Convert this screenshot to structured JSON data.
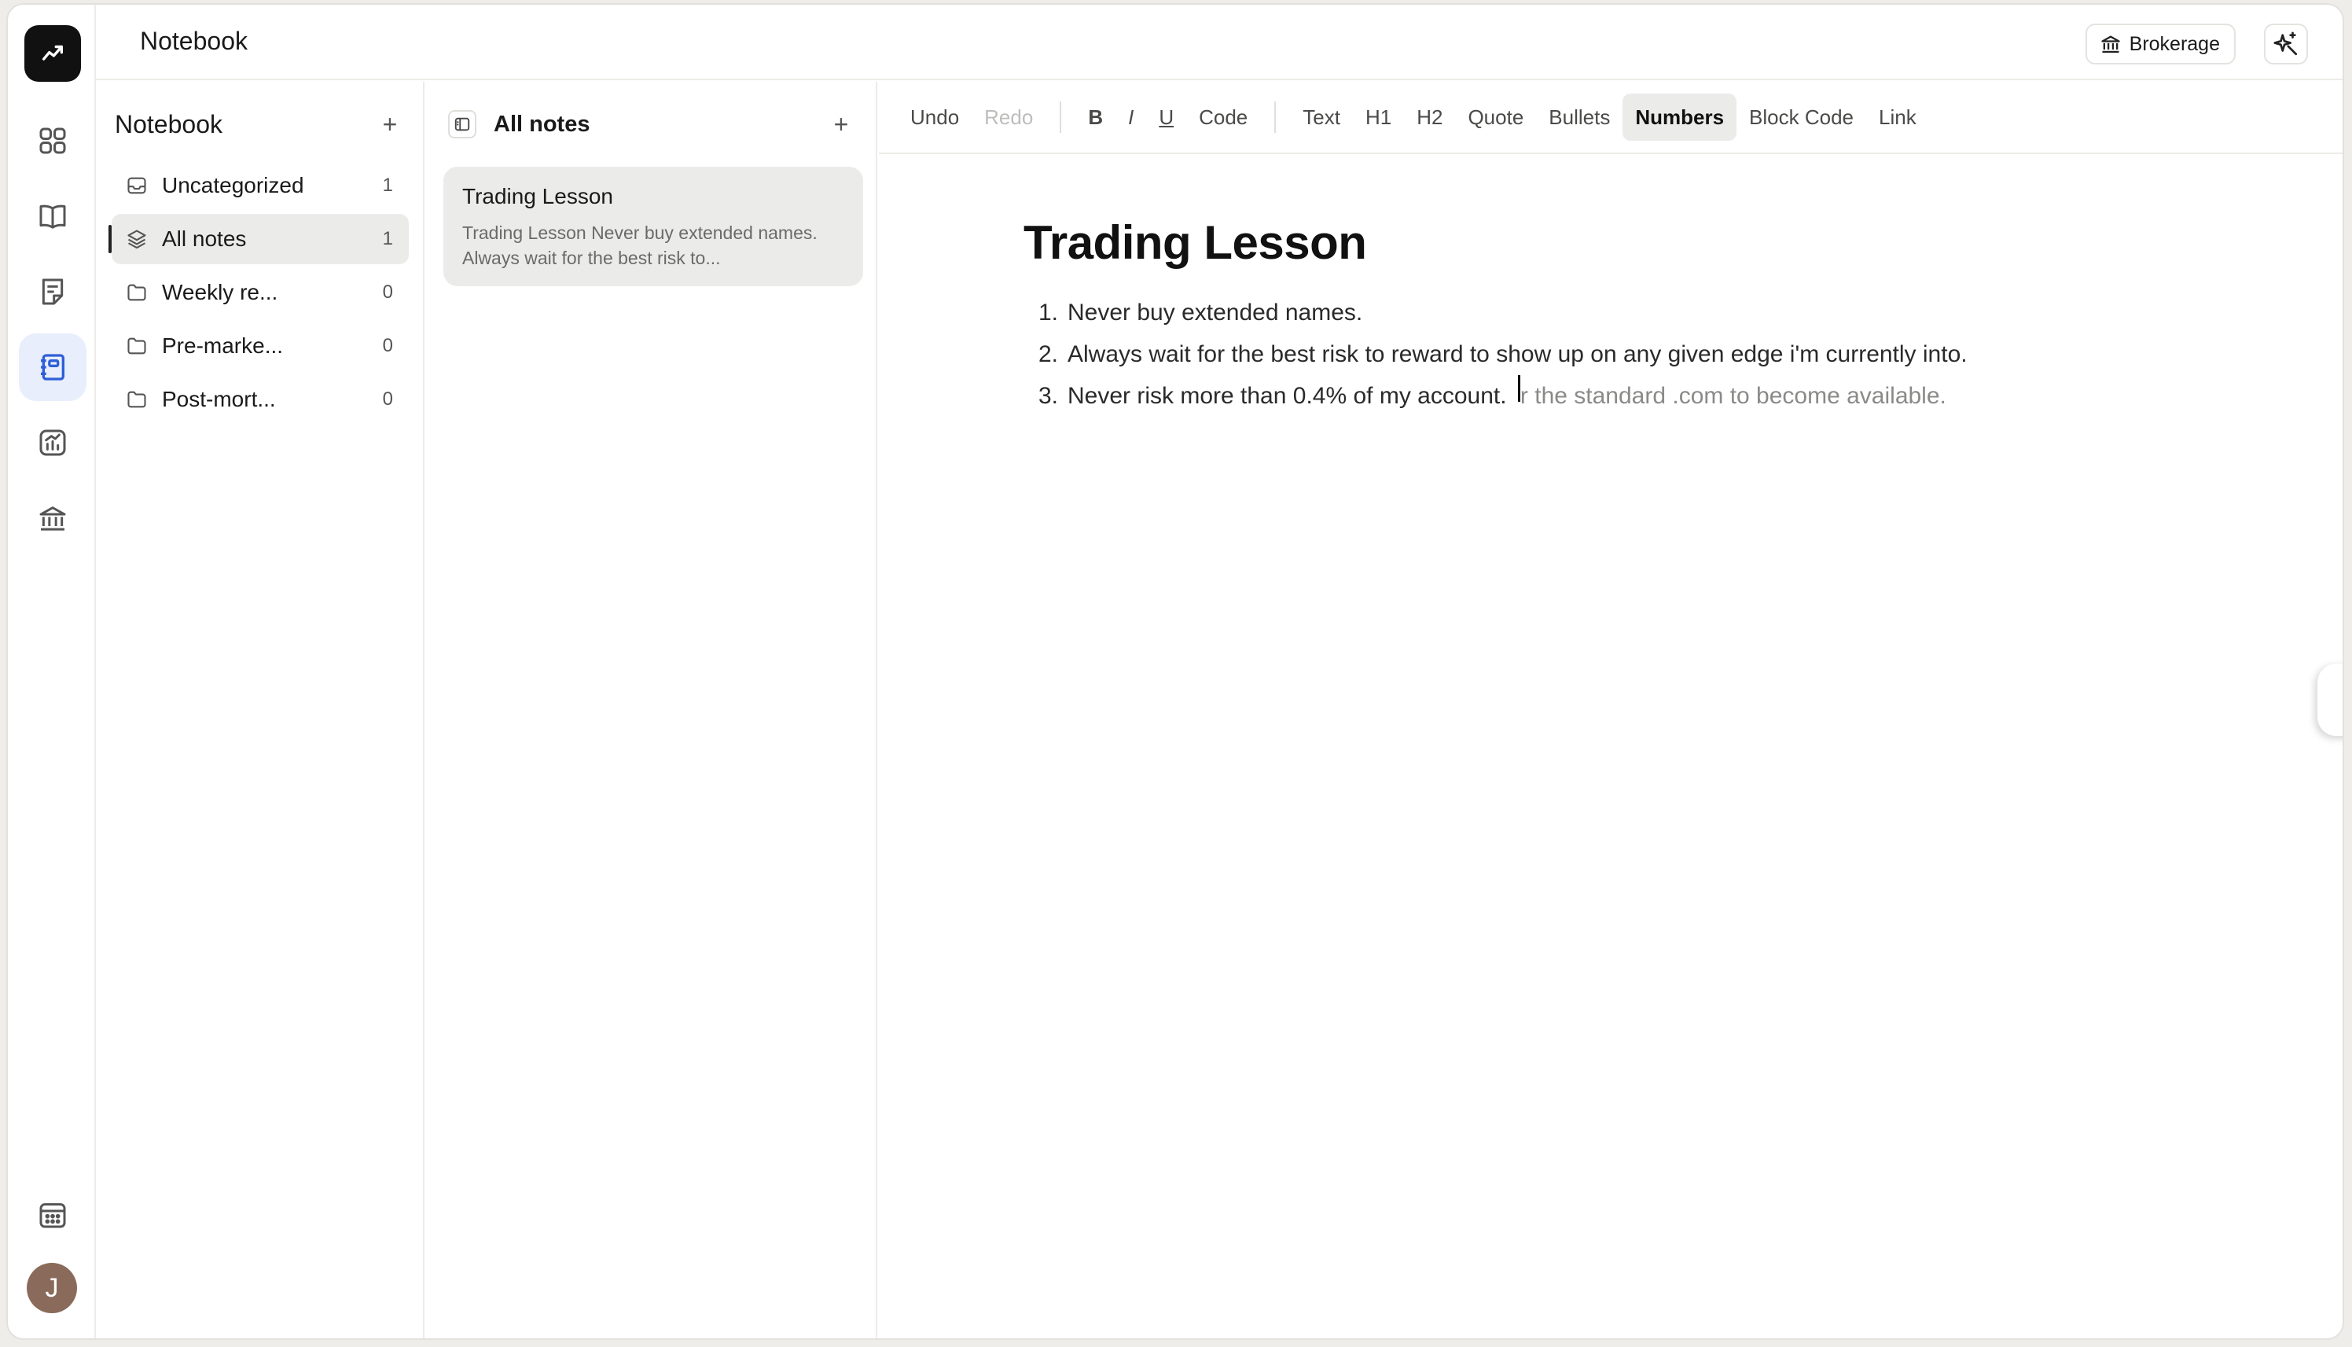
{
  "app": {
    "title": "Notebook",
    "brokerage_label": "Brokerage",
    "avatar_initial": "J"
  },
  "rail": {
    "items": [
      {
        "name": "dashboard-icon"
      },
      {
        "name": "journal-book-icon"
      },
      {
        "name": "notes-icon"
      },
      {
        "name": "notebook-icon",
        "active": true
      },
      {
        "name": "analytics-icon"
      },
      {
        "name": "bank-icon"
      }
    ],
    "bottom": [
      "calendar-icon"
    ]
  },
  "sidebar": {
    "title": "Notebook",
    "add_label": "+",
    "folders": [
      {
        "label": "Uncategorized",
        "count": "1",
        "icon": "inbox-icon"
      },
      {
        "label": "All notes",
        "count": "1",
        "icon": "layers-icon",
        "active": true
      },
      {
        "label": "Weekly re...",
        "count": "0",
        "icon": "folder-icon"
      },
      {
        "label": "Pre-marke...",
        "count": "0",
        "icon": "folder-icon"
      },
      {
        "label": "Post-mort...",
        "count": "0",
        "icon": "folder-icon"
      }
    ]
  },
  "notes": {
    "title": "All notes",
    "add_label": "+",
    "items": [
      {
        "title": "Trading Lesson",
        "preview": "Trading Lesson Never buy extended names. Always wait for the best risk to..."
      }
    ]
  },
  "toolbar": {
    "undo": "Undo",
    "redo": "Redo",
    "bold": "B",
    "italic": "I",
    "underline": "U",
    "code": "Code",
    "text": "Text",
    "h1": "H1",
    "h2": "H2",
    "quote": "Quote",
    "bullets": "Bullets",
    "numbers": "Numbers",
    "block_code": "Block Code",
    "link": "Link"
  },
  "document": {
    "title": "Trading Lesson",
    "items": [
      {
        "num": "1.",
        "text": "Never buy extended names."
      },
      {
        "num": "2.",
        "text": "Always wait for the best risk to reward to show up on any given edge i'm currently into."
      },
      {
        "num": "3.",
        "text": "Never risk more than 0.4% of my account. ",
        "suggestion": "r the standard .com to become available."
      }
    ]
  },
  "colors": {
    "accent": "#e8eefb",
    "active_bg": "#ebebea",
    "logo_bg": "#111111"
  }
}
